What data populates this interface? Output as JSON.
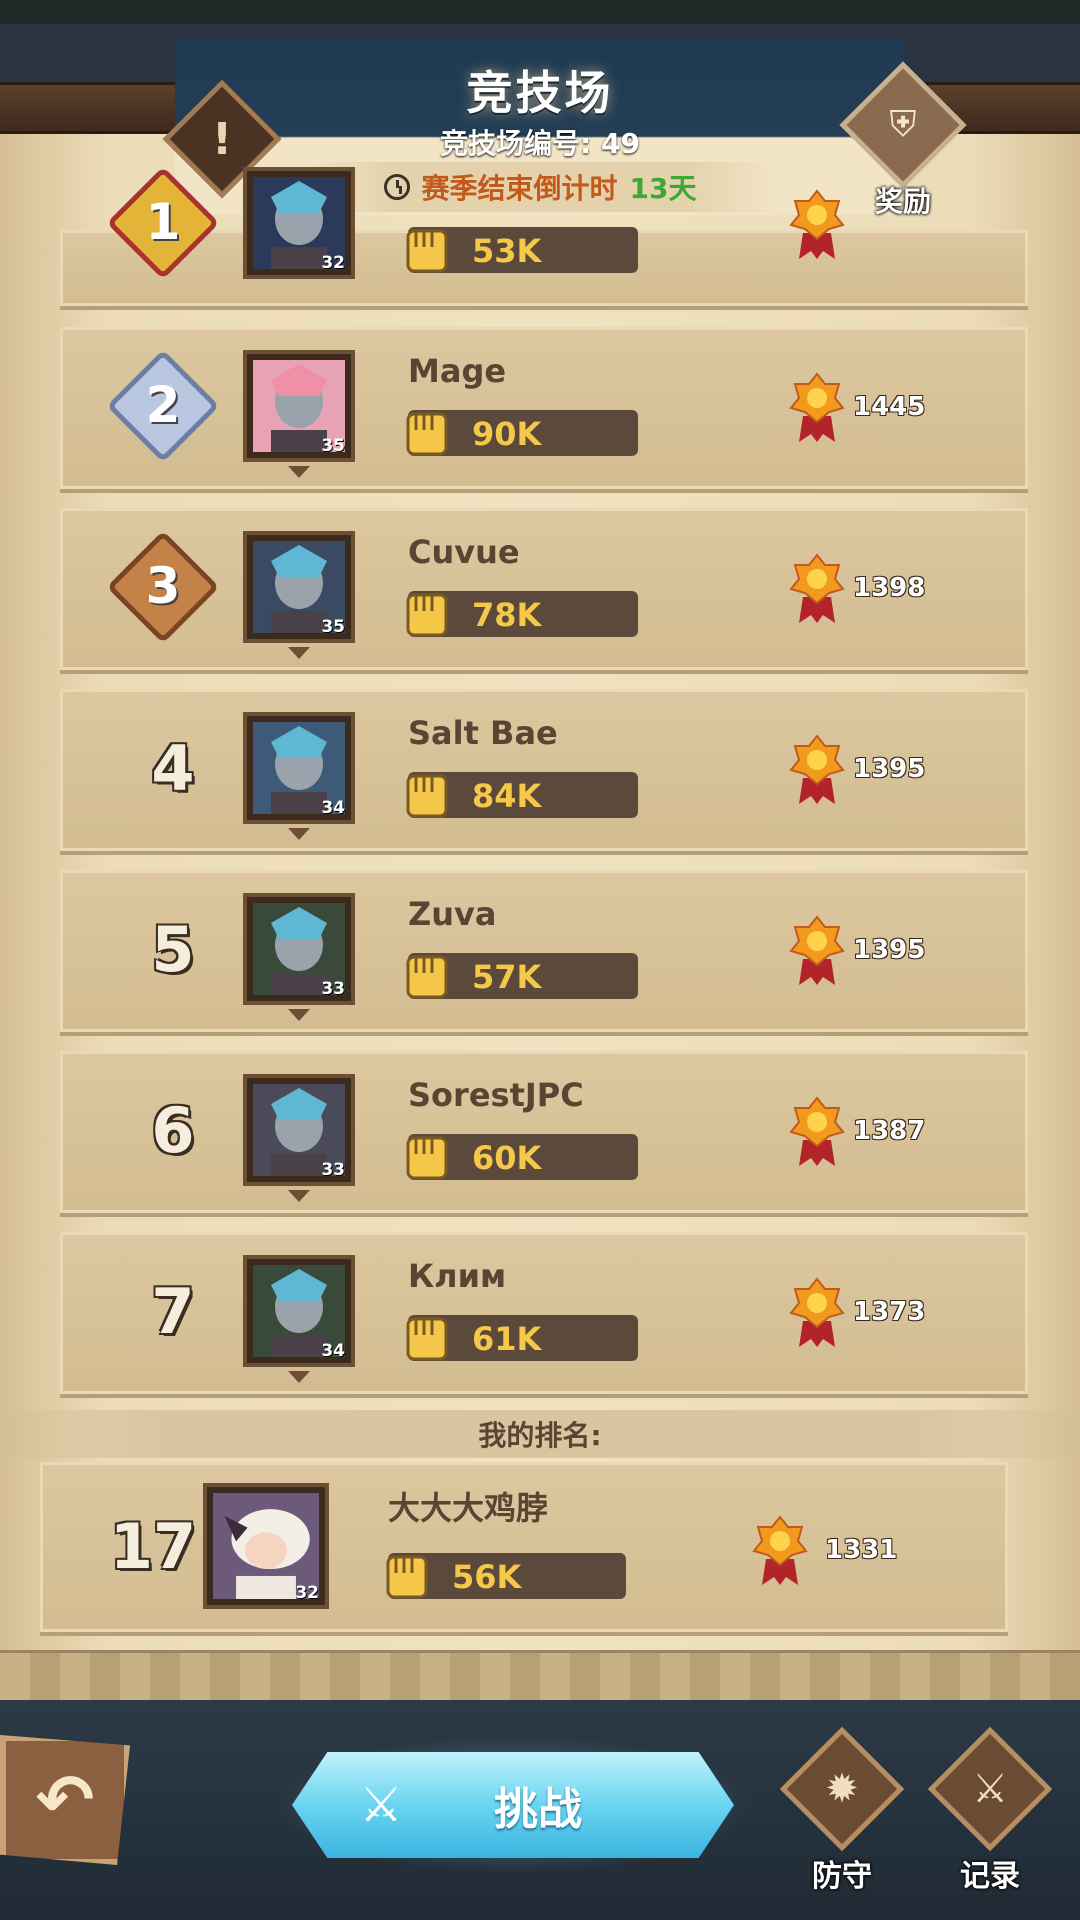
{
  "header": {
    "title": "竞技场",
    "arena_number": "竞技场编号: 49",
    "season_label": "赛季结束倒计时",
    "season_days": "13天",
    "reward_label": "奖励",
    "notice_glyph": "!"
  },
  "rows": [
    {
      "rank": "1",
      "name": "",
      "level": "32",
      "power": "53K",
      "score": "",
      "medal": "gold"
    },
    {
      "rank": "2",
      "name": "Mage",
      "level": "35",
      "power": "90K",
      "score": "1445",
      "medal": "silver"
    },
    {
      "rank": "3",
      "name": "Cuvue",
      "level": "35",
      "power": "78K",
      "score": "1398",
      "medal": "bronze"
    },
    {
      "rank": "4",
      "name": "Salt Bae",
      "level": "34",
      "power": "84K",
      "score": "1395"
    },
    {
      "rank": "5",
      "name": "Zuva",
      "level": "33",
      "power": "57K",
      "score": "1395"
    },
    {
      "rank": "6",
      "name": "SorestJPC",
      "level": "33",
      "power": "60K",
      "score": "1387"
    },
    {
      "rank": "7",
      "name": "Клим",
      "level": "34",
      "power": "61K",
      "score": "1373"
    }
  ],
  "my_rank": {
    "label": "我的排名:",
    "rank": "17",
    "name": "大大大鸡脖",
    "level": "32",
    "power": "56K",
    "score": "1331"
  },
  "bottom": {
    "back_glyph": "↶",
    "challenge_label": "挑战",
    "defense_label": "防守",
    "record_label": "记录"
  },
  "colors": {
    "power_text": "#f6c84a",
    "season_label": "#c25a1c",
    "season_days": "#3fa832",
    "challenge": "#6ad5f0"
  },
  "icons": [
    "clock-icon",
    "fist-icon",
    "trophy-icon",
    "swords-icon",
    "back-arrow-icon",
    "shield-icon",
    "scroll-icon"
  ]
}
